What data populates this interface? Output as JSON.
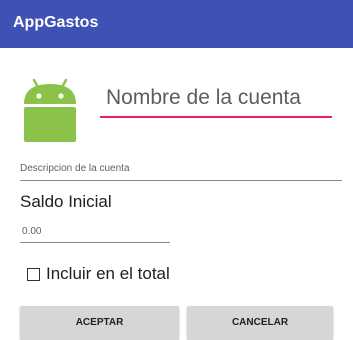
{
  "appbar": {
    "title": "AppGastos",
    "color": "#3f51b5"
  },
  "avatar": {
    "icon": "android-icon",
    "color": "#8bc34a"
  },
  "form": {
    "name_field": {
      "value": "Nombre de la cuenta",
      "accent": "#e91e63"
    },
    "description_field": {
      "value": "Descripcion de la cuenta"
    },
    "saldo_label": "Saldo Inicial",
    "saldo_field": {
      "value": "0.00"
    },
    "include_total": {
      "label": "Incluir en el total",
      "checked": false
    }
  },
  "buttons": {
    "accept": "ACEPTAR",
    "cancel": "CANCELAR"
  }
}
